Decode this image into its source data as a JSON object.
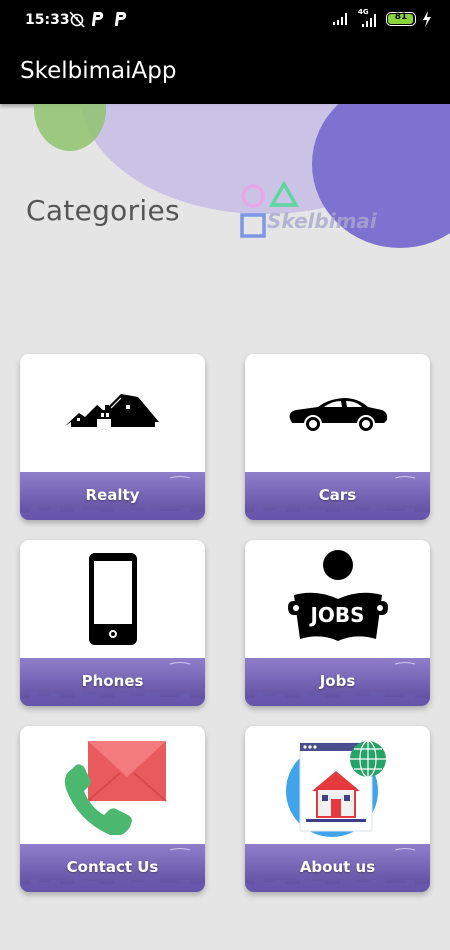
{
  "status_bar": {
    "time": "15:33",
    "network_label": "4G",
    "battery_level": "81",
    "icons": [
      "alarm-off-icon",
      "parking-p-icon",
      "parking-p-icon",
      "signal-icon",
      "signal-4g-icon",
      "battery-icon",
      "charging-icon"
    ]
  },
  "app_bar": {
    "title": "SkelbimaiApp"
  },
  "header": {
    "title": "Categories",
    "logo_text": "Skelbimai"
  },
  "categories": [
    {
      "label": "Realty",
      "icon": "houses-icon"
    },
    {
      "label": "Cars",
      "icon": "car-icon"
    },
    {
      "label": "Phones",
      "icon": "phone-icon"
    },
    {
      "label": "Jobs",
      "icon": "jobs-icon",
      "icon_text": "JOBS"
    },
    {
      "label": "Contact Us",
      "icon": "contact-icon"
    },
    {
      "label": "About us",
      "icon": "about-icon"
    }
  ],
  "colors": {
    "banner_top": "#8f7fcb",
    "banner_bottom": "#5b4a9c",
    "blob_purple": "#7f73cf",
    "blob_light": "#c5bde3",
    "blob_green": "#8fc36e"
  }
}
